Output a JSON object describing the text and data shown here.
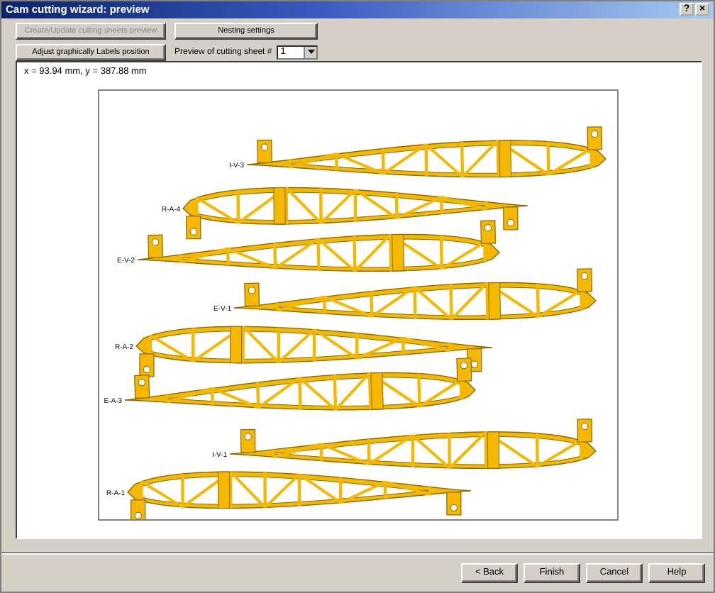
{
  "window": {
    "title": "Cam cutting wizard: preview",
    "title_buttons": [
      "?",
      "×"
    ]
  },
  "toolbar": {
    "buttons": [
      {
        "label": "Create/Update cutting sheets preview",
        "disabled": true
      },
      {
        "label": "Nesting settings",
        "disabled": false
      },
      {
        "label": "Adjust graphically Labels position",
        "disabled": false
      }
    ],
    "sheet_picker": {
      "label": "Preview of cutting sheet #",
      "value": "1"
    }
  },
  "preview": {
    "cursor_position": "x = 93.94 mm, y = 387.88 mm",
    "ribs": [
      {
        "label": "I-V-3",
        "kind": "nose_right"
      },
      {
        "label": "R-A-4",
        "kind": "nose_left"
      },
      {
        "label": "E-V-2",
        "kind": "nose_right"
      },
      {
        "label": "E-V-1",
        "kind": "nose_right"
      },
      {
        "label": "R-A-2",
        "kind": "nose_left"
      },
      {
        "label": "E-A-3",
        "kind": "nose_right"
      },
      {
        "label": "I-V-1",
        "kind": "nose_right"
      },
      {
        "label": "R-A-1",
        "kind": "nose_left"
      }
    ]
  },
  "buttons": [
    {
      "label": "< Back"
    },
    {
      "label": "Finish"
    },
    {
      "label": "Cancel"
    },
    {
      "label": "Help"
    }
  ]
}
